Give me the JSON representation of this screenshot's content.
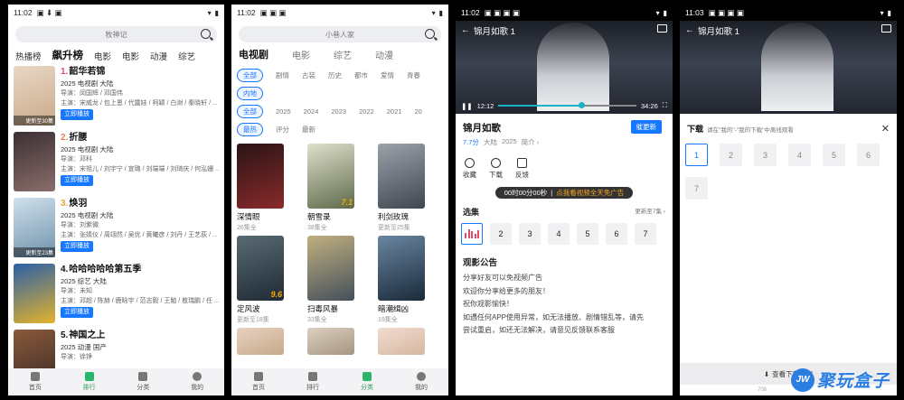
{
  "status": {
    "time": "11:02",
    "time4": "11:03"
  },
  "screen1": {
    "search_placeholder": "牧神记",
    "tabs": [
      "热播榜",
      "飙升榜",
      "电影",
      "电影",
      "动漫",
      "综艺"
    ],
    "list": [
      {
        "rank": "1.",
        "title": "韶华若锦",
        "year": "2025 电视剧 大陆",
        "director": "导演：闵国辉 / 邓国伟",
        "cast": "主演：宋威龙 / 包上恩 / 代露娃 / 柯颖 / 白澍 / 秦晓轩 / ...",
        "badge": "更新至30集",
        "btn": "立即播放",
        "color": "#c9a98a"
      },
      {
        "rank": "2.",
        "title": "折腰",
        "year": "2025 电视剧 大陆",
        "director": "导演：邓科",
        "cast": "主演：宋祖儿 / 刘宇宁 / 宣璐 / 刘端端 / 刘琦庆 / 何泓姗 ...",
        "badge": "",
        "btn": "立即播放",
        "color": "#6e5a55"
      },
      {
        "rank": "3.",
        "title": "焕羽",
        "year": "2025 电视剧 大陆",
        "director": "导演：刘紫微",
        "cast": "主演：张婧仪 / 周翊然 / 吴优 / 黄曦彦 / 刘丹 / 王艺荻 / ...",
        "badge": "更新至23集",
        "btn": "立即播放",
        "color": "#7da0b9"
      },
      {
        "rank": "4.",
        "title": "哈哈哈哈哈第五季",
        "year": "2025 综艺 大陆",
        "director": "导演：未知",
        "cast": "主演：邓超 / 陈赫 / 鹿晗宇 / 范志毅 / 王勉 / 敖瑞鹏 / 任 ...",
        "badge": "",
        "btn": "立即播放",
        "color": "#e2b32c"
      },
      {
        "rank": "5.",
        "title": "神国之上",
        "year": "2025 动漫 国产",
        "director": "导演：徐铮",
        "cast": "",
        "badge": "",
        "btn": "",
        "color": "#6b4a3a"
      }
    ],
    "nav": [
      "首页",
      "排行",
      "分类",
      "我的"
    ]
  },
  "screen2": {
    "search_placeholder": "小巷人家",
    "tabs": [
      "电视剧",
      "电影",
      "综艺",
      "动漫"
    ],
    "row1": [
      "全部",
      "剧情",
      "古装",
      "历史",
      "都市",
      "爱情",
      "青春"
    ],
    "row2": [
      "内地"
    ],
    "row3": [
      "全部",
      "2025",
      "2024",
      "2023",
      "2022",
      "2021",
      "20"
    ],
    "row4": [
      "最热",
      "评分",
      "最新"
    ],
    "grid": [
      {
        "name": "深情眼",
        "status": "26集全",
        "score": "",
        "color": "#8a2a2a"
      },
      {
        "name": "朝雪录",
        "status": "38集全",
        "score": "7.1",
        "color": "#5e6a4a"
      },
      {
        "name": "利剑玫瑰",
        "status": "更新至25集",
        "score": "",
        "color": "#3f4650"
      },
      {
        "name": "定风波",
        "status": "更新至18集",
        "score": "9.6",
        "color": "#2e3a45"
      },
      {
        "name": "扫毒风暴",
        "status": "33集全",
        "score": "",
        "color": "#45505a"
      },
      {
        "name": "暗潮缉凶",
        "status": "19集全",
        "score": "",
        "color": "#2a3f55"
      },
      {
        "name": "",
        "status": "",
        "score": "",
        "color": "#c7a88a"
      },
      {
        "name": "",
        "status": "",
        "score": "",
        "color": "#a59580"
      },
      {
        "name": "",
        "status": "",
        "score": "",
        "color": "#d7b7a0"
      }
    ],
    "nav": [
      "首页",
      "排行",
      "分类",
      "我的"
    ]
  },
  "screen3": {
    "video_title": "锦月如歌 1",
    "cur_time": "12:12",
    "total_time": "34:26",
    "title": "锦月如歌",
    "score": "7.7分",
    "region": "大陆",
    "year": "2025",
    "intro": "简介",
    "urge": "催更新",
    "actions": [
      "收藏",
      "下载",
      "反馈"
    ],
    "timer": "00时00分00秒",
    "timer_ad": "点我看视频全天免广告",
    "episodes_label": "选集",
    "episodes_more": "更新至7集",
    "episodes": [
      "1",
      "2",
      "3",
      "4",
      "5",
      "6",
      "7"
    ],
    "ann_title": "观影公告",
    "ann_lines": [
      "分享好友可以免视频广告",
      "欢迎你分享给更多的朋友！",
      "祝你观影愉快！",
      "如遇任何APP使用异常，如无法播放、剧情错乱等，请先",
      "尝试重启，如还无法解决，请意见反馈联系客服"
    ]
  },
  "screen4": {
    "video_title": "锦月如歌 1",
    "dl_title": "下载",
    "dl_hint": "请在\"我的\"-\"我的下载\"中离线观看",
    "episodes": [
      "1",
      "2",
      "3",
      "4",
      "5",
      "6",
      "7"
    ],
    "foot": "查看下载内容",
    "foot_small": "708",
    "watermark": "聚玩盒子",
    "watermark_logo": "JW"
  }
}
